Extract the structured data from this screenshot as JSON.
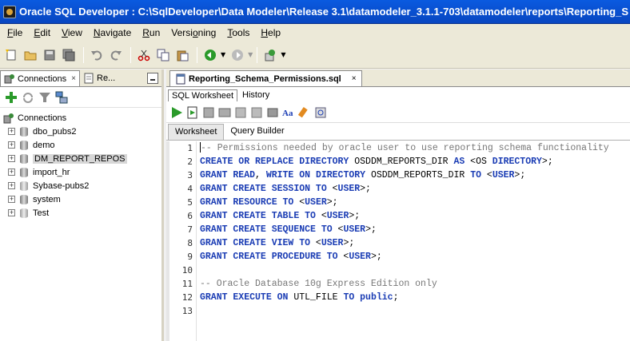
{
  "window": {
    "title": "Oracle SQL Developer : C:\\SqlDeveloper\\Data Modeler\\Release 3.1\\datamodeler_3.1.1-703\\datamodeler\\reports\\Reporting_S"
  },
  "menu": [
    {
      "label": "File",
      "u": "F",
      "rest": "ile"
    },
    {
      "label": "Edit",
      "u": "E",
      "rest": "dit"
    },
    {
      "label": "View",
      "u": "V",
      "rest": "iew"
    },
    {
      "label": "Navigate",
      "u": "N",
      "rest": "avigate"
    },
    {
      "label": "Run",
      "u": "R",
      "rest": "un"
    },
    {
      "label": "Versioning",
      "pre": "Versi",
      "u": "o",
      "rest": "ning"
    },
    {
      "label": "Tools",
      "u": "T",
      "rest": "ools"
    },
    {
      "label": "Help",
      "u": "H",
      "rest": "elp"
    }
  ],
  "left_panel": {
    "tab_connections": "Connections",
    "tab_reports": "Re...",
    "tree_root": "Connections",
    "connections": [
      {
        "label": "dbo_pubs2",
        "selected": false
      },
      {
        "label": "demo",
        "selected": false
      },
      {
        "label": "DM_REPORT_REPOS",
        "selected": true
      },
      {
        "label": "import_hr",
        "selected": false
      },
      {
        "label": "Sybase-pubs2",
        "selected": false
      },
      {
        "label": "system",
        "selected": false
      },
      {
        "label": "Test",
        "selected": false
      }
    ]
  },
  "editor": {
    "tab_title": "Reporting_Schema_Permissions.sql",
    "sub_tabs": [
      "SQL Worksheet",
      "History"
    ],
    "ws_tabs": [
      "Worksheet",
      "Query Builder"
    ],
    "line_numbers": [
      "1",
      "2",
      "3",
      "4",
      "5",
      "6",
      "7",
      "8",
      "9",
      "10",
      "11",
      "12",
      "13"
    ],
    "lines": [
      [
        {
          "t": "-- Permissions needed by oracle user to use reporting schema functionality",
          "c": "cm"
        }
      ],
      [
        {
          "t": "CREATE OR REPLACE DIRECTORY",
          "c": "kw"
        },
        {
          "t": " OSDDM_REPORTS_DIR ",
          "c": ""
        },
        {
          "t": "AS",
          "c": "kw"
        },
        {
          "t": " <OS ",
          "c": ""
        },
        {
          "t": "DIRECTORY",
          "c": "kw"
        },
        {
          "t": ">;",
          "c": ""
        }
      ],
      [
        {
          "t": "GRANT READ",
          "c": "kw"
        },
        {
          "t": ", ",
          "c": ""
        },
        {
          "t": "WRITE ON DIRECTORY",
          "c": "kw"
        },
        {
          "t": " OSDDM_REPORTS_DIR ",
          "c": ""
        },
        {
          "t": "TO",
          "c": "kw"
        },
        {
          "t": " <",
          "c": ""
        },
        {
          "t": "USER",
          "c": "kw"
        },
        {
          "t": ">;",
          "c": ""
        }
      ],
      [
        {
          "t": "GRANT CREATE SESSION TO",
          "c": "kw"
        },
        {
          "t": " <",
          "c": ""
        },
        {
          "t": "USER",
          "c": "kw"
        },
        {
          "t": ">;",
          "c": ""
        }
      ],
      [
        {
          "t": "GRANT RESOURCE TO",
          "c": "kw"
        },
        {
          "t": " <",
          "c": ""
        },
        {
          "t": "USER",
          "c": "kw"
        },
        {
          "t": ">;",
          "c": ""
        }
      ],
      [
        {
          "t": "GRANT CREATE TABLE TO",
          "c": "kw"
        },
        {
          "t": " <",
          "c": ""
        },
        {
          "t": "USER",
          "c": "kw"
        },
        {
          "t": ">;",
          "c": ""
        }
      ],
      [
        {
          "t": "GRANT CREATE SEQUENCE TO",
          "c": "kw"
        },
        {
          "t": " <",
          "c": ""
        },
        {
          "t": "USER",
          "c": "kw"
        },
        {
          "t": ">;",
          "c": ""
        }
      ],
      [
        {
          "t": "GRANT CREATE VIEW TO",
          "c": "kw"
        },
        {
          "t": " <",
          "c": ""
        },
        {
          "t": "USER",
          "c": "kw"
        },
        {
          "t": ">;",
          "c": ""
        }
      ],
      [
        {
          "t": "GRANT CREATE PROCEDURE TO",
          "c": "kw"
        },
        {
          "t": " <",
          "c": ""
        },
        {
          "t": "USER",
          "c": "kw"
        },
        {
          "t": ">;",
          "c": ""
        }
      ],
      [
        {
          "t": "",
          "c": ""
        }
      ],
      [
        {
          "t": "-- Oracle Database 10g Express Edition only",
          "c": "cm"
        }
      ],
      [
        {
          "t": "GRANT EXECUTE ON",
          "c": "kw"
        },
        {
          "t": " UTL_FILE ",
          "c": ""
        },
        {
          "t": "TO public",
          "c": "kw"
        },
        {
          "t": ";",
          "c": ""
        }
      ],
      [
        {
          "t": "",
          "c": ""
        }
      ]
    ]
  },
  "colors": {
    "keyword": "#1a3cb4",
    "comment": "#777777",
    "title_bar": "#0a5ae0"
  }
}
